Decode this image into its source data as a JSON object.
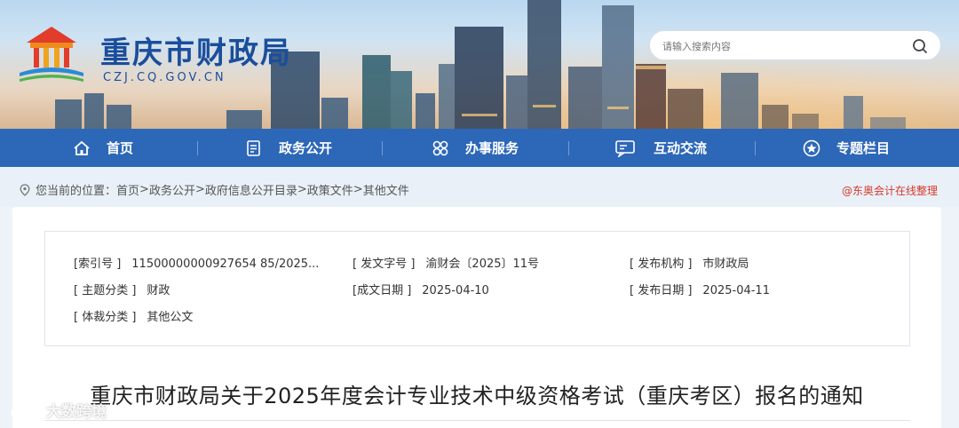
{
  "header": {
    "site_title": "重庆市财政局",
    "site_domain": "CZJ.CQ.GOV.CN"
  },
  "search": {
    "placeholder": "请输入搜索内容",
    "icon": "search-icon"
  },
  "nav": {
    "items": [
      {
        "label": "首页",
        "icon": "home-icon"
      },
      {
        "label": "政务公开",
        "icon": "document-icon"
      },
      {
        "label": "办事服务",
        "icon": "services-icon"
      },
      {
        "label": "互动交流",
        "icon": "chat-icon"
      },
      {
        "label": "专题栏目",
        "icon": "star-icon"
      }
    ]
  },
  "breadcrumb": {
    "prefix": "您当前的位置：",
    "items": [
      "首页",
      "政务公开",
      "政府信息公开目录",
      "政策文件",
      "其他文件"
    ],
    "separator": ">"
  },
  "watermark_top": "@东奥会计在线整理",
  "meta": {
    "index_label": "[索引号 ]",
    "index_value": "11500000000927654 85/2025...",
    "doc_no_label": "[ 发文字号 ]",
    "doc_no_value": "渝财会〔2025〕11号",
    "issuer_label": "[ 发布机构 ]",
    "issuer_value": "市财政局",
    "topic_label": "[ 主题分类 ]",
    "topic_value": "财政",
    "created_label": "[成文日期 ]",
    "created_value": "2025-04-10",
    "published_label": "[ 发布日期 ]",
    "published_value": "2025-04-11",
    "genre_label": "[ 体裁分类 ]",
    "genre_value": "其他公文"
  },
  "document": {
    "title": "重庆市财政局关于2025年度会计专业技术中级资格考试（重庆考区）报名的通知"
  },
  "watermark_bottom": "大数跨境",
  "colors": {
    "nav_bg": "#2d67b8",
    "brand_blue": "#1a4e9c",
    "watermark_red": "#d9372b"
  }
}
